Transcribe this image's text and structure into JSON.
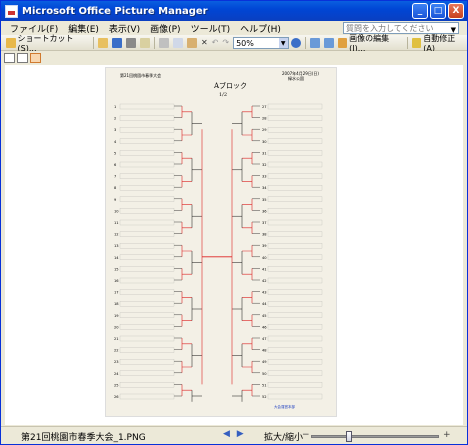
{
  "window": {
    "title": "Microsoft Office Picture Manager",
    "title_buttons": [
      "_",
      "□",
      "X"
    ]
  },
  "menu": [
    "ファイル(F)",
    "編集(E)",
    "表示(V)",
    "画像(P)",
    "ツール(T)",
    "ヘルプ(H)"
  ],
  "help_search_placeholder": "質問を入力してください",
  "toolbar": {
    "shortcuts": "ショートカット(S)...",
    "zoom": "50%",
    "edit_picture": "画像の編集(I)...",
    "auto_correct": "自動修正(A)"
  },
  "document": {
    "header_left": "第21回桃園市春季大会",
    "header_right_date": "2007年4月29日(日)",
    "header_right_venue": "緑水公園",
    "block_title": "Aブロック",
    "page_fraction": "1/2",
    "left_entries": [
      "1",
      "2",
      "3",
      "4",
      "5",
      "6",
      "7",
      "8",
      "9",
      "10",
      "11",
      "12",
      "13",
      "14",
      "15",
      "16",
      "17",
      "18",
      "19",
      "20",
      "21",
      "22",
      "23",
      "24",
      "25",
      "26"
    ],
    "right_entries": [
      "27",
      "28",
      "29",
      "30",
      "31",
      "32",
      "33",
      "34",
      "35",
      "36",
      "37",
      "38",
      "39",
      "40",
      "41",
      "42",
      "43",
      "44",
      "45",
      "46",
      "47",
      "48",
      "49",
      "50",
      "51",
      "52"
    ],
    "footer_note": "大会運営本部"
  },
  "status": {
    "filename": "第21回桃園市春季大会_1.PNG",
    "zoom_label": "拡大/縮小",
    "zoom_position": 0.28
  }
}
